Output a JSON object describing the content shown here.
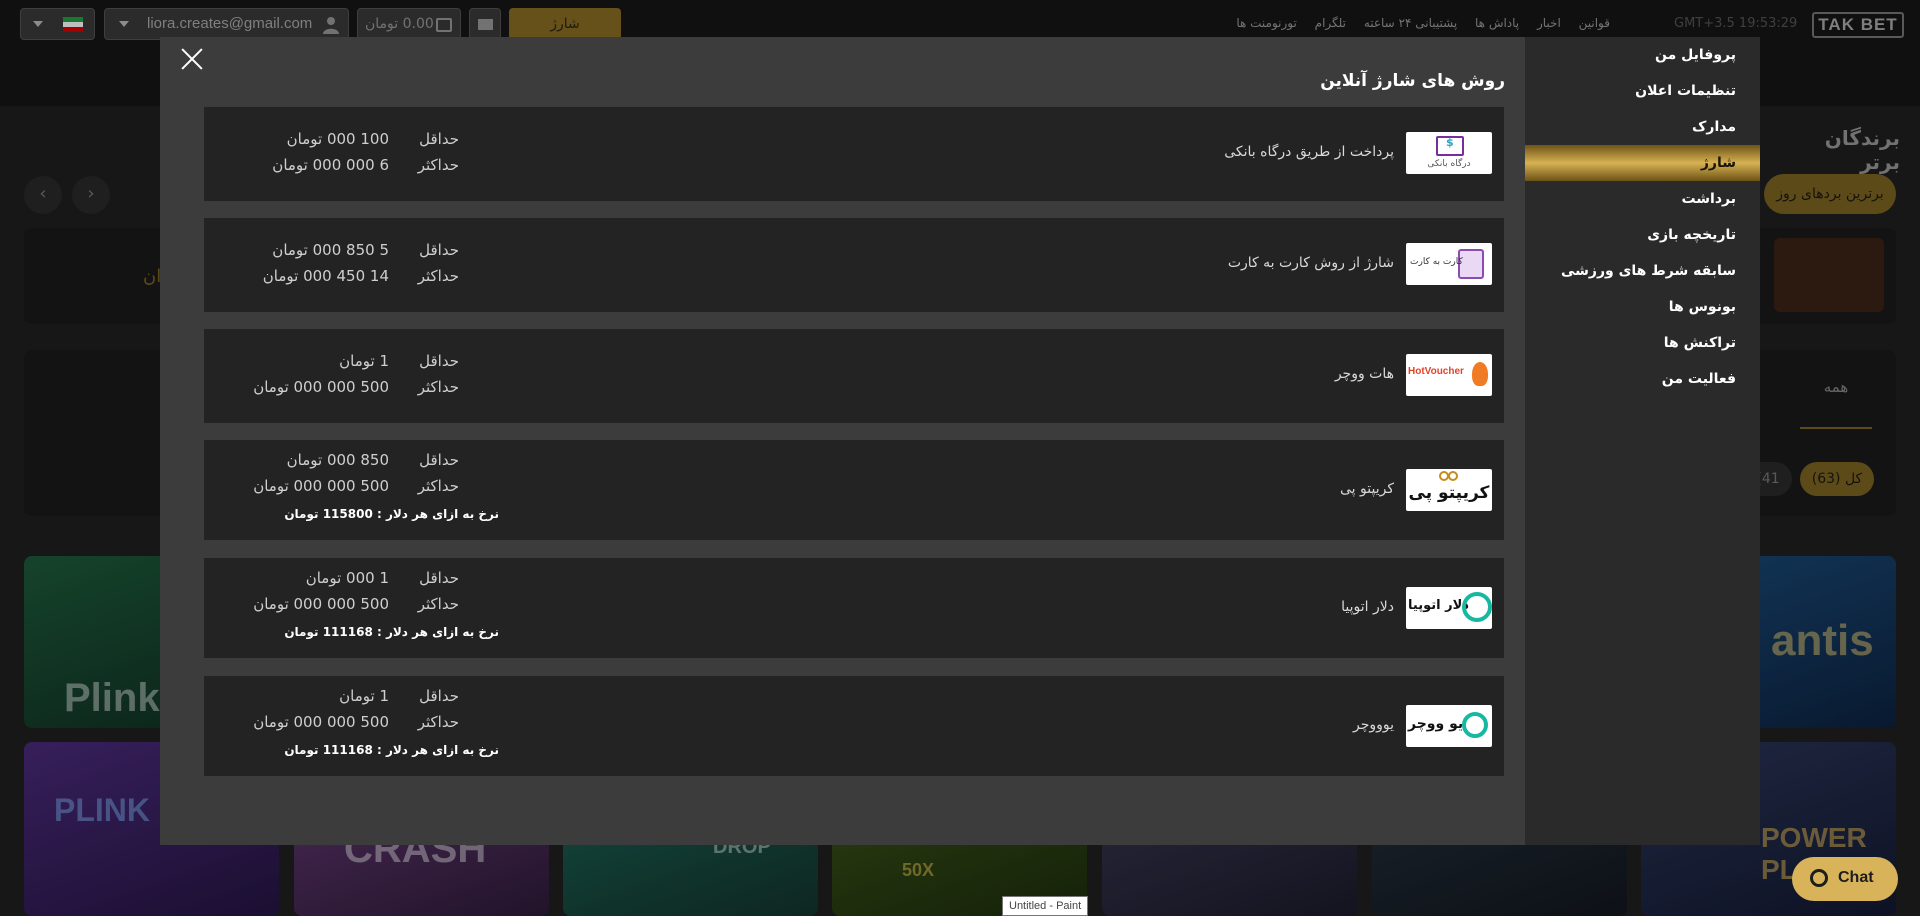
{
  "topbar": {
    "charge_label": "شارژ",
    "balance": "0.00 تومان",
    "email": "liora.creates@gmail.com",
    "nav": [
      "قوانین",
      "اخبار",
      "پاداش ها",
      "پشتیبانی ۲۴ ساعته",
      "تلگرام",
      "تورنومنت ها"
    ],
    "time": "GMT+3.5  19:53:29",
    "logo": "TAK BET"
  },
  "background": {
    "section_title": "برندگان برتر",
    "top_wins_pill": "برترین بردهای روز",
    "tab_all": "همه",
    "count_all": "(63) کل",
    "count_other": "(41",
    "partial_text": "ان",
    "games": [
      "Plink",
      "PLINK PARTY",
      "CRASH",
      "DROP",
      "50X",
      "",
      "",
      "POWER PLAY",
      "antis"
    ]
  },
  "modal": {
    "title": "روش های شارژ آنلاین",
    "sidebar": [
      "پروفایل من",
      "تنظیمات اعلان",
      "مدارک",
      "شارژ",
      "برداشت",
      "تاریخچه بازی",
      "سابقه شرط های ورزشی",
      "بونوس ها",
      "تراکنش ها",
      "فعالیت من"
    ],
    "active_index": 3,
    "min_label": "حداقل",
    "max_label": "حداکثر",
    "methods": [
      {
        "name": "پرداخت از طریق درگاه بانکی",
        "logo": "bank-gateway-logo",
        "logo_text": "درگاه بانکی",
        "min": "100 000 تومان",
        "max": "6 000 000 تومان",
        "rate": ""
      },
      {
        "name": "شارژ از روش کارت به کارت",
        "logo": "card-to-card-logo",
        "logo_text": "کارت به کارت",
        "min": "5 850 000 تومان",
        "max": "14 450 000 تومان",
        "rate": ""
      },
      {
        "name": "هات ووچر",
        "logo": "hot-voucher-logo",
        "logo_text": "HotVoucher",
        "min": "1 تومان",
        "max": "500 000 000 تومان",
        "rate": ""
      },
      {
        "name": "کریپتو پی",
        "logo": "crypto-pay-logo",
        "logo_text": "کریپتو پی",
        "min": "850 000 تومان",
        "max": "500 000 000 تومان",
        "rate": "نرخ به ازای هر دلار : 115800 تومان"
      },
      {
        "name": "دلار اتوپیا",
        "logo": "utopia-dollar-logo",
        "logo_text": "دلار اتوپیا",
        "min": "1 000 تومان",
        "max": "500 000 000 تومان",
        "rate": "نرخ به ازای هر دلار : 111168 تومان"
      },
      {
        "name": "یوووچر",
        "logo": "youvoucher-logo",
        "logo_text": "یو ووچر",
        "min": "1 تومان",
        "max": "500 000 000 تومان",
        "rate": "نرخ به ازای هر دلار : 111168 تومان"
      }
    ]
  },
  "chat": {
    "label": "Chat"
  },
  "taskbar_tooltip": "Untitled - Paint",
  "colors": {
    "accent_gold": "#d7b153",
    "modal_bg": "#3c3c3c",
    "card_bg": "#232323",
    "sidebar_bg": "#2a2a2a"
  }
}
